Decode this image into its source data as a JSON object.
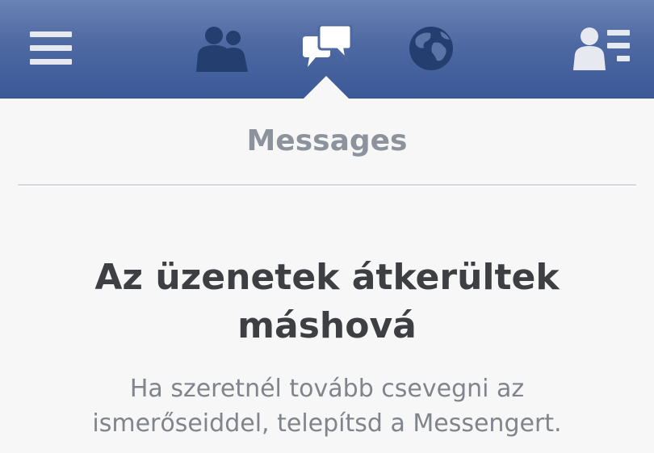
{
  "colors": {
    "topbar": "#3b5998",
    "icon_inactive": "#253e70",
    "icon_active": "#ffffff",
    "background": "#f7f7f7",
    "section_title": "#8d939c",
    "headline": "#3d3f43",
    "body_text": "#80848b"
  },
  "topbar": {
    "icons": [
      "menu-icon",
      "friend-requests-icon",
      "messages-icon",
      "notifications-globe-icon",
      "contacts-list-icon"
    ],
    "active": "messages-icon"
  },
  "section": {
    "title": "Messages"
  },
  "notice": {
    "headline_line1": "Az üzenetek átkerültek",
    "headline_line2": "máshová",
    "body_line1": "Ha szeretnél tovább csevegni az",
    "body_line2": "ismerőseiddel, telepítsd a Messengert."
  }
}
